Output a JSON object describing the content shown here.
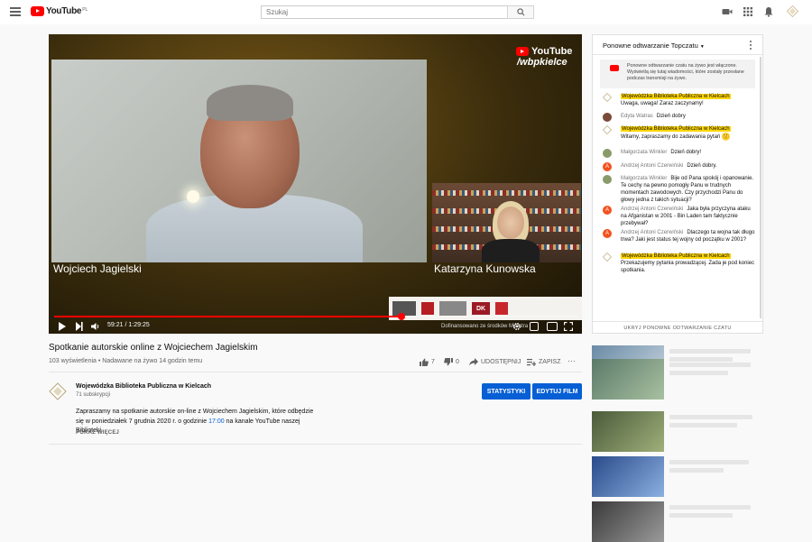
{
  "header": {
    "logo_text": "YouTube",
    "region": "PL",
    "search_placeholder": "Szukaj",
    "icons": [
      "menu-icon",
      "search-icon",
      "create-video-icon",
      "apps-icon",
      "notifications-icon",
      "account-avatar"
    ]
  },
  "player": {
    "speaker_left": "Wojciech Jagielski",
    "speaker_right": "Katarzyna Kunowska",
    "watermark_line1": "YouTube",
    "watermark_line2": "/wbpkielce",
    "time_current": "59:21",
    "time_total": "1:29:25",
    "progress": 0.663,
    "sponsor_caption": "Dofinansowano ze środków Ministra",
    "sponsor_dk": "DK"
  },
  "video": {
    "title": "Spotkanie autorskie online z Wojciechem Jagielskim",
    "views": "103 wyświetlenia",
    "streamed": "Nadawane na żywo 14 godzin temu",
    "likes": "7",
    "dislikes": "0",
    "share_label": "UDOSTĘPNIJ",
    "save_label": "ZAPISZ",
    "more_label": "···"
  },
  "channel": {
    "name": "Wojewódzka Biblioteka Publiczna w Kielcach",
    "subscribers": "71 subskrypcji",
    "stats_button": "STATYSTYKI",
    "edit_button": "EDYTUJ FILM"
  },
  "description": {
    "text_before": "Zapraszamy na spotkanie autorskie on-line z Wojciechem Jagielskim, które odbędzie się w poniedziałek 7 grudnia 2020 r. o godzinie ",
    "time_link": "17:00",
    "text_after": " na kanale YouTube naszej Biblioteki.",
    "show_more": "POKAŻ WIĘCEJ"
  },
  "chat": {
    "title": "Ponowne odtwarzanie Topczatu",
    "notice": "Ponowne odtwarzanie czatu na żywo jest włączone. Wyświetlą się tutaj wiadomości, które zostały przesłane podczas transmisji na żywo.",
    "footer": "UKRYJ PONOWNE ODTWARZANIE CZATU",
    "messages": [
      {
        "author": "Wojewódzka Biblioteka Publiczna w Kielcach",
        "text": "Uwaga, uwaga! Zaraz zaczynamy!",
        "owner": true
      },
      {
        "author": "Edyta Watras",
        "text": "Dzień dobry",
        "owner": false
      },
      {
        "author": "Wojewódzka Biblioteka Publiczna w Kielcach",
        "text": "Witamy, zapraszamy do zadawania pytań",
        "emoji": "🙂",
        "owner": true
      },
      {
        "author": "Małgorzata Winkler",
        "text": "Dzień dobry!",
        "owner": false
      },
      {
        "author": "Andrzej Antoni Czerwiński",
        "text": "Dzień dobry.",
        "owner": false
      },
      {
        "author": "Małgorzata Winkler",
        "text": "Bije od Pana spokój i opanowanie. Te cechy na pewno pomogły Panu w trudnych momentach zawodowych. Czy przychodzi Panu do głowy jedna z takich sytuacji?",
        "owner": false
      },
      {
        "author": "Andrzej Antoni Czerwiński",
        "text": "Jaka była przyczyna ataku na Afganistan w 2001 - Bin Laden tam faktycznie przebywał?",
        "owner": false
      },
      {
        "author": "Andrzej Antoni Czerwiński",
        "text": "Dlaczego ta wojna tak długo trwa? Jaki jest status tej wojny od początku w 2001?",
        "owner": false
      },
      {
        "author": "Wojewódzka Biblioteka Publiczna w Kielcach",
        "text": "Przekazujemy pytania prowadzącej. Zada je pod koniec spotkania.",
        "owner": true
      }
    ]
  },
  "colors": {
    "brand_red": "#ff0000",
    "button_blue": "#065fd4",
    "owner_highlight": "#ffd600"
  }
}
